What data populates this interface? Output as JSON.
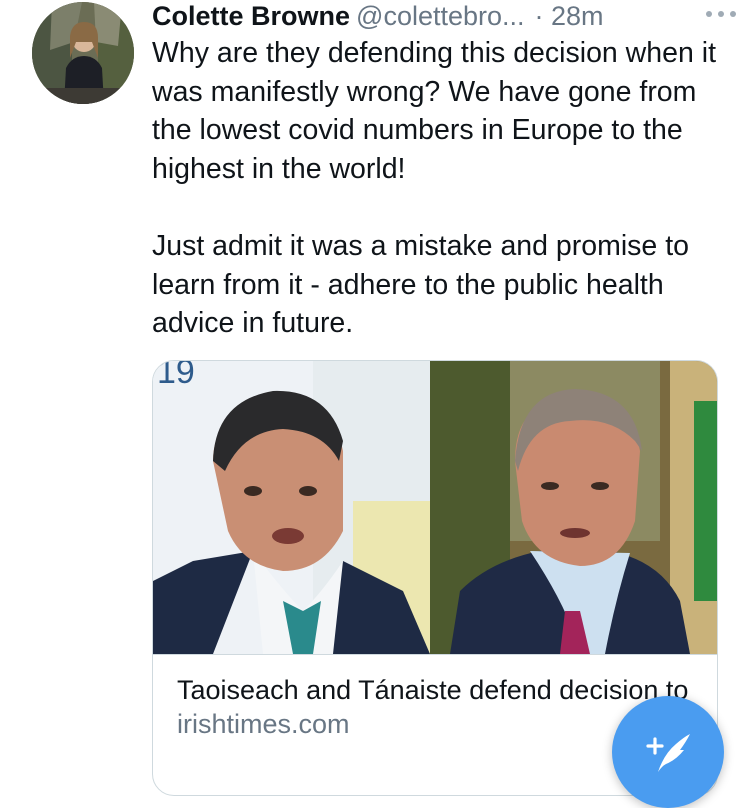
{
  "tweet": {
    "author_name": "Colette Browne",
    "author_handle": "@colettebro...",
    "time": "· 28m",
    "more_icon": "more-dots-icon",
    "paragraphs": [
      "Why are they defending this decision when it was manifestly wrong? We have gone from the lowest covid numbers in Europe to the highest in the world!",
      "Just admit it was a mistake and promise to learn from it - adhere to the public health advice in future."
    ]
  },
  "card": {
    "title": "Taoiseach and Tánaiste defend decision to lift restrictions before",
    "domain": "irishtimes.com",
    "image_corner_text": "19"
  },
  "fab": {
    "icon": "compose-tweet-icon",
    "color": "#4a9cf0"
  },
  "colors": {
    "text": "#0f1419",
    "secondary": "#687684",
    "border": "#cfd9de",
    "accent": "#4a9cf0"
  }
}
